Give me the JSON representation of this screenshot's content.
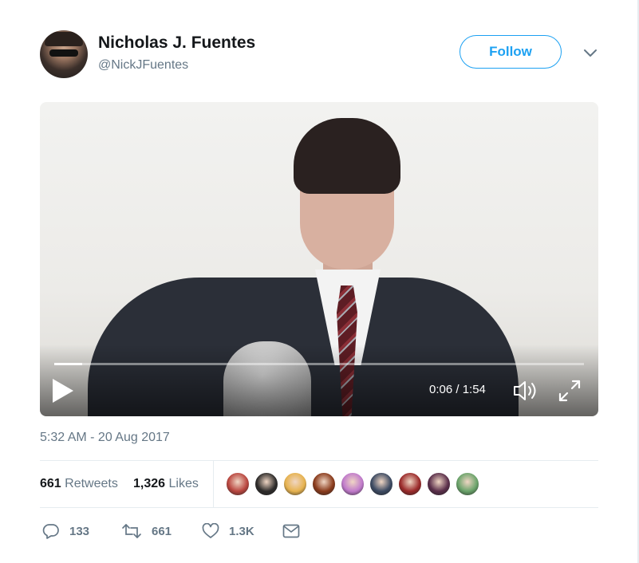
{
  "tweet": {
    "author_name": "Nicholas J. Fuentes",
    "author_handle": "@NickJFuentes",
    "follow_label": "Follow",
    "timestamp": "5:32 AM - 20 Aug 2017"
  },
  "video": {
    "current_time": "0:06",
    "duration": "1:54",
    "time_display": "0:06 / 1:54",
    "progress_fraction": 0.053
  },
  "stats": {
    "retweets_count": "661",
    "retweets_label": "Retweets",
    "likes_count": "1,326",
    "likes_label": "Likes"
  },
  "actions": {
    "reply_count": "133",
    "retweet_count": "661",
    "like_count": "1.3K"
  },
  "likers": [
    {
      "color": "#b9463f"
    },
    {
      "color": "#2d2b2a"
    },
    {
      "color": "#e6b24f"
    },
    {
      "color": "#8a3b1c"
    },
    {
      "color": "#c07acb"
    },
    {
      "color": "#3c4a62"
    },
    {
      "color": "#9b2a2a"
    },
    {
      "color": "#5a2e4a"
    },
    {
      "color": "#6aa36a"
    }
  ],
  "colors": {
    "accent": "#1da1f2",
    "secondary_text": "#657786",
    "primary_text": "#14171a",
    "divider": "#e6ecf0"
  },
  "icons": [
    "chevron-down-icon",
    "play-icon",
    "volume-icon",
    "fullscreen-icon",
    "reply-icon",
    "retweet-icon",
    "like-icon",
    "message-icon"
  ]
}
